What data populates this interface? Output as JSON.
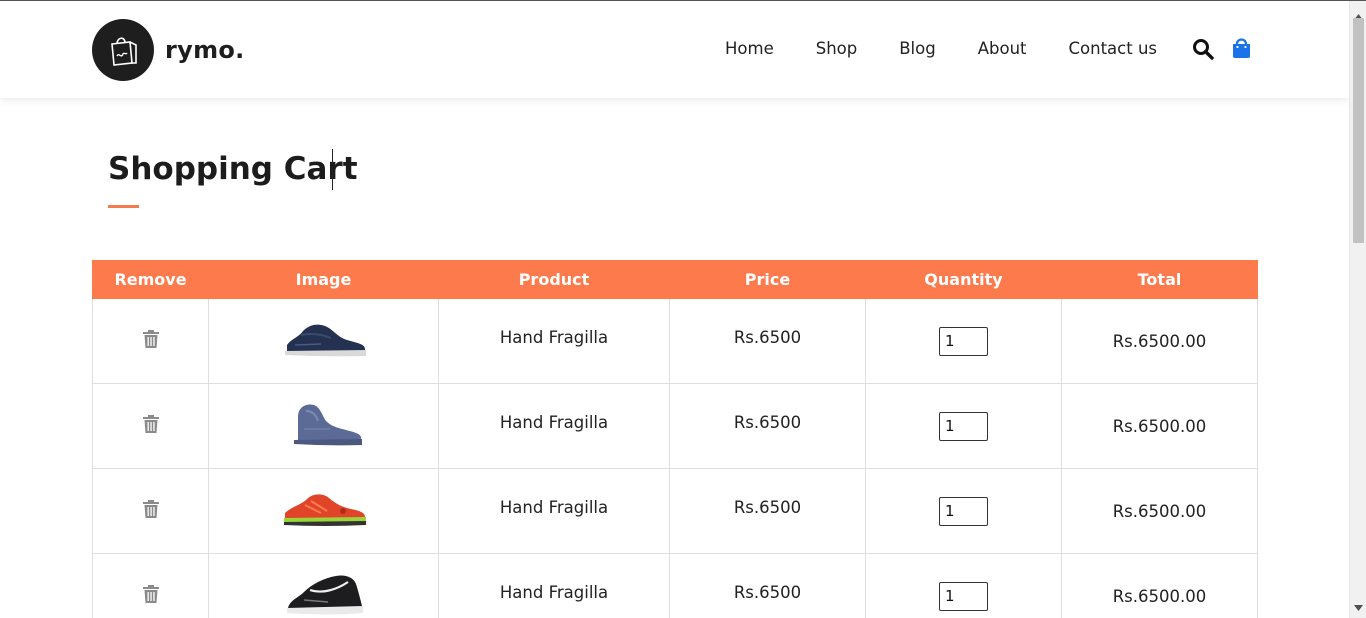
{
  "brand": {
    "name": "rymo."
  },
  "nav": {
    "items": [
      "Home",
      "Shop",
      "Blog",
      "About",
      "Contact us"
    ]
  },
  "icons": {
    "search": "search-icon",
    "cart": "shopping-bag-icon",
    "accent_blue": "#1a73e8"
  },
  "page": {
    "title": "Shopping Cart",
    "accent": "#f47a4f"
  },
  "table": {
    "headers": [
      "Remove",
      "Image",
      "Product",
      "Price",
      "Quantity",
      "Total"
    ],
    "header_color": "#fd7a4c",
    "rows": [
      {
        "product": "Hand Fragilla",
        "price": "Rs.6500",
        "quantity": "1",
        "total": "Rs.6500.00",
        "image": "navy-running-shoe"
      },
      {
        "product": "Hand Fragilla",
        "price": "Rs.6500",
        "quantity": "1",
        "total": "Rs.6500.00",
        "image": "blue-high-top-shoe"
      },
      {
        "product": "Hand Fragilla",
        "price": "Rs.6500",
        "quantity": "1",
        "total": "Rs.6500.00",
        "image": "orange-running-shoe"
      },
      {
        "product": "Hand Fragilla",
        "price": "Rs.6500",
        "quantity": "1",
        "total": "Rs.6500.00",
        "image": "black-running-shoe"
      }
    ]
  }
}
